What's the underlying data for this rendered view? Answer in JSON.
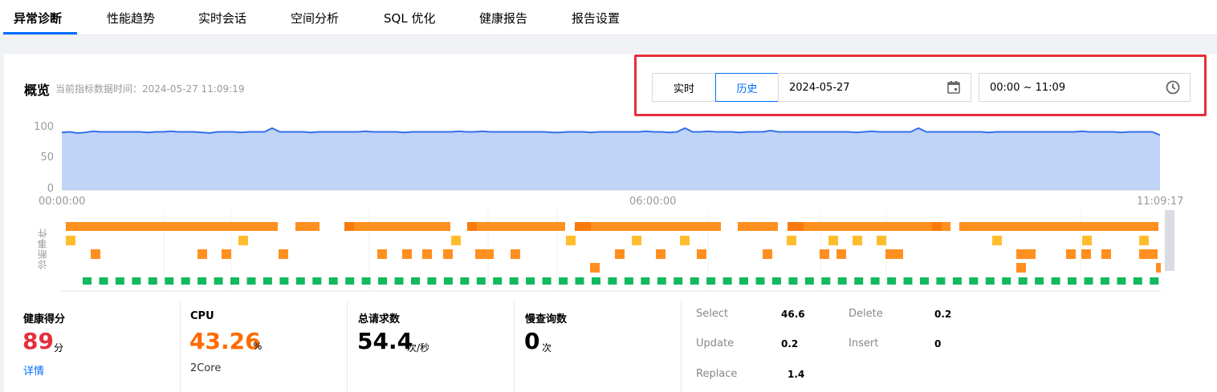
{
  "tabs": [
    {
      "label": "异常诊断",
      "active": true
    },
    {
      "label": "性能趋势"
    },
    {
      "label": "实时会话"
    },
    {
      "label": "空间分析"
    },
    {
      "label": "SQL 优化"
    },
    {
      "label": "健康报告"
    },
    {
      "label": "报告设置"
    }
  ],
  "overview": {
    "title": "概览",
    "data_time": "当前指标数据时间：2024-05-27 11:09:19"
  },
  "time_controls": {
    "realtime_label": "实时",
    "history_label": "历史",
    "mode": "历史",
    "date": "2024-05-27",
    "time_range": "00:00 ~ 11:09"
  },
  "chart_data": {
    "type": "area",
    "y_ticks": [
      "100",
      "50",
      "0"
    ],
    "x_ticks": [
      "00:00:00",
      "06:00:00",
      "11:09:17"
    ],
    "ylim": [
      0,
      100
    ],
    "values": [
      92,
      93,
      91,
      92,
      94,
      93,
      93,
      93,
      93,
      93,
      93,
      92,
      93,
      93,
      94,
      93,
      93,
      93,
      92,
      91,
      93,
      93,
      93,
      92,
      93,
      93,
      93,
      99,
      93,
      93,
      93,
      93,
      92,
      93,
      93,
      93,
      93,
      93,
      93,
      94,
      93,
      93,
      93,
      93,
      92,
      93,
      93,
      93,
      93,
      93,
      93,
      94,
      93,
      93,
      94,
      93,
      93,
      93,
      93,
      93,
      93,
      93,
      93,
      92,
      92,
      93,
      93,
      93,
      92,
      93,
      93,
      93,
      93,
      93,
      93,
      94,
      93,
      93,
      92,
      93,
      99,
      93,
      93,
      94,
      93,
      93,
      93,
      92,
      93,
      93,
      93,
      95,
      93,
      93,
      93,
      93,
      93,
      93,
      93,
      93,
      93,
      93,
      92,
      93,
      94,
      93,
      93,
      93,
      93,
      93,
      99,
      93,
      93,
      93,
      93,
      93,
      93,
      93,
      93,
      92,
      93,
      93,
      93,
      93,
      93,
      93,
      93,
      93,
      93,
      93,
      93,
      94,
      93,
      93,
      93,
      93,
      92,
      93,
      93,
      93,
      93,
      88
    ],
    "color": "#3370eb",
    "fill": "#c0d4f7"
  },
  "events": {
    "label": "诊断事件",
    "colors": {
      "bar": "#ff8f1f",
      "bar_dark": "#f97a0c",
      "warn": "#ffbd2e",
      "ok": "#13b85f"
    }
  },
  "metrics": {
    "health": {
      "title": "健康得分",
      "value": "89",
      "unit": "分",
      "link": "详情",
      "color": "#e5303a"
    },
    "cpu": {
      "title": "CPU",
      "value": "43.26",
      "unit": "%",
      "sub": "2Core",
      "color": "#ff6a00"
    },
    "requests": {
      "title": "总请求数",
      "value": "54.4",
      "unit": "次/秒"
    },
    "slow": {
      "title": "慢查询数",
      "value": "0",
      "unit": "次"
    },
    "queries": [
      {
        "label": "Select",
        "value": "46.6"
      },
      {
        "label": "Delete",
        "value": "0.2"
      },
      {
        "label": "Update",
        "value": "0.2"
      },
      {
        "label": "Insert",
        "value": "0"
      },
      {
        "label": "Replace",
        "value": "1.4"
      }
    ]
  }
}
